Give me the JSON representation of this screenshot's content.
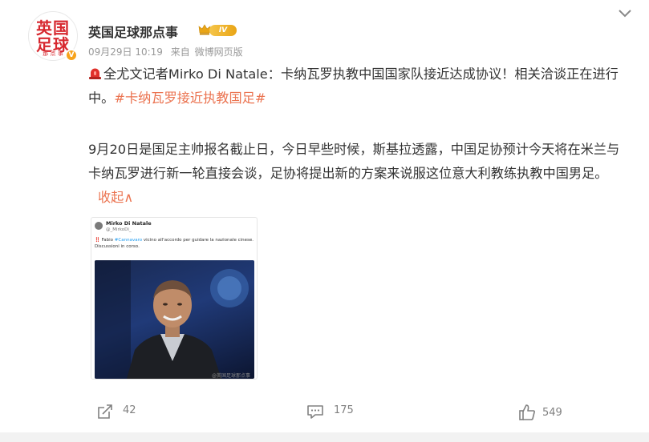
{
  "post": {
    "author": {
      "name": "英国足球那点事",
      "avatar_line1": "英国",
      "avatar_line2": "足球",
      "avatar_line3": "那 点 事",
      "verified_badge": "V",
      "level_badge": "IV",
      "level_icon": "crown-icon"
    },
    "meta": {
      "time": "09月29日 10:19",
      "source_prefix": "来自",
      "source": "微博网页版"
    },
    "menu_icon": "chevron-down-icon",
    "paragraph1": {
      "siren_icon": "siren-icon",
      "text": "全尤文记者Mirko Di Natale：卡纳瓦罗执教中国国家队接近达成协议！相关洽谈正在进行中。",
      "topic": "#卡纳瓦罗接近执教国足#"
    },
    "paragraph2": {
      "text": "9月20日是国足主帅报名截止日，今日早些时候，斯基拉透露，中国足协预计今天将在米兰与卡纳瓦罗进行新一轮直接会谈，足协将提出新的方案来说服这位意大利教练执教中国男足。",
      "collapse_label": "收起∧"
    },
    "embedded_image": {
      "tweet_name": "Mirko Di Natale",
      "tweet_handle": "@_MirkoDi_",
      "tweet_bang": "‼️",
      "tweet_text_a": "Fabio ",
      "tweet_link": "#Cannavaro",
      "tweet_text_b": " vicino all'accordo per guidare la nazionale cinese.",
      "tweet_text_c": "Discussioni in corso.",
      "watermark": "@英国足球那点事"
    },
    "actions": {
      "share_count": "42",
      "comment_count": "175",
      "like_count": "549"
    },
    "colors": {
      "accent": "#eb7350",
      "verified": "#f7a21b",
      "text": "#333333",
      "muted": "#999999"
    }
  }
}
